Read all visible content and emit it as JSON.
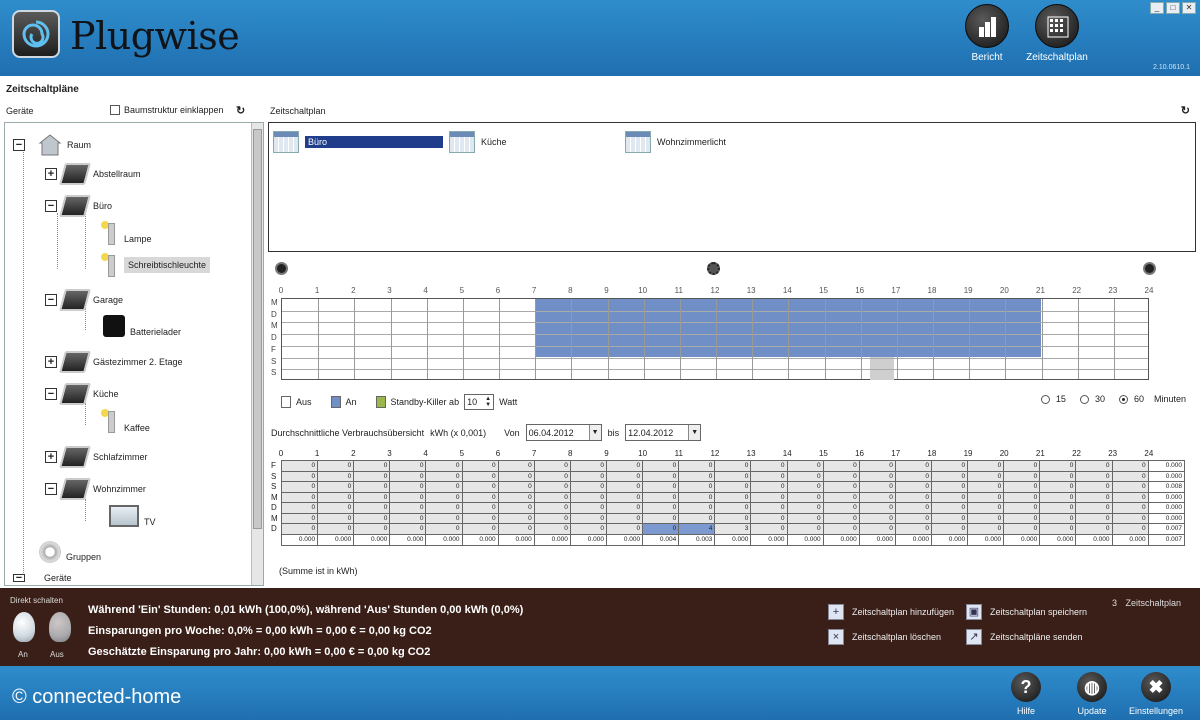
{
  "app": {
    "brand": "Plugwise",
    "version": "2.10.0610.1",
    "window_controls": [
      "_",
      "□",
      "✕"
    ],
    "header_buttons": [
      {
        "label": "Bericht",
        "icon": "report-chart-icon"
      },
      {
        "label": "Zeitschaltplan",
        "icon": "schedule-grid-icon"
      }
    ]
  },
  "page_title": "Zeitschaltpläne",
  "left": {
    "header": "Geräte",
    "collapse_label": "Baumstruktur einklappen",
    "refresh_icon": "refresh-icon",
    "tree": [
      {
        "label": "Raum",
        "pm": "−"
      },
      {
        "label": "Abstellraum",
        "pm": "+"
      },
      {
        "label": "Büro",
        "pm": "−"
      },
      {
        "label": "Lampe"
      },
      {
        "label": "Schreibtischleuchte"
      },
      {
        "label": "Garage",
        "pm": "−"
      },
      {
        "label": "Batterielader"
      },
      {
        "label": "Gästezimmer 2. Etage",
        "pm": "+"
      },
      {
        "label": "Küche",
        "pm": "−"
      },
      {
        "label": "Kaffee"
      },
      {
        "label": "Schlafzimmer",
        "pm": "+"
      },
      {
        "label": "Wohnzimmer",
        "pm": "−"
      },
      {
        "label": "TV"
      },
      {
        "label": "Gruppen"
      },
      {
        "label": "Geräte"
      }
    ]
  },
  "right": {
    "header": "Zeitschaltplan",
    "schedules": [
      "Büro",
      "Küche",
      "Wohnzimmerlicht"
    ],
    "hours": [
      "0",
      "1",
      "2",
      "3",
      "4",
      "5",
      "6",
      "7",
      "8",
      "9",
      "10",
      "11",
      "12",
      "13",
      "14",
      "15",
      "16",
      "17",
      "18",
      "19",
      "20",
      "21",
      "22",
      "23",
      "24"
    ],
    "day_letters": [
      "M",
      "D",
      "M",
      "D",
      "F",
      "S",
      "S"
    ],
    "legend": {
      "aus": "Aus",
      "an": "An",
      "standby": "Standby-Killer ab",
      "watt_value": "10",
      "watt_unit": "Watt",
      "colors": {
        "aus": "#ffffff",
        "an": "#6f8fc6",
        "standby": "#9ab84a"
      }
    },
    "interval": {
      "options": [
        "15",
        "30",
        "60"
      ],
      "selected": "60",
      "unit": "Minuten"
    }
  },
  "consumption": {
    "title": "Durchschnittliche Verbrauchsübersicht",
    "unit": "kWh (x 0,001)",
    "von_label": "Von",
    "von_value": "06.04.2012",
    "bis_label": "bis",
    "bis_value": "12.04.2012",
    "day_letters": [
      "F",
      "S",
      "S",
      "M",
      "D",
      "M",
      "D"
    ],
    "rows": [
      [
        "0",
        "0",
        "0",
        "0",
        "0",
        "0",
        "0",
        "0",
        "0",
        "0",
        "0",
        "0",
        "0",
        "0",
        "0",
        "0",
        "0",
        "0",
        "0",
        "0",
        "0",
        "0",
        "0",
        "0",
        "0.000"
      ],
      [
        "0",
        "0",
        "0",
        "0",
        "0",
        "0",
        "0",
        "0",
        "0",
        "0",
        "0",
        "0",
        "0",
        "0",
        "0",
        "0",
        "0",
        "0",
        "0",
        "0",
        "0",
        "0",
        "0",
        "0",
        "0.000"
      ],
      [
        "0",
        "0",
        "0",
        "0",
        "0",
        "0",
        "0",
        "0",
        "0",
        "0",
        "0",
        "0",
        "0",
        "0",
        "0",
        "0",
        "0",
        "0",
        "0",
        "0",
        "0",
        "0",
        "0",
        "0",
        "0.008"
      ],
      [
        "0",
        "0",
        "0",
        "0",
        "0",
        "0",
        "0",
        "0",
        "0",
        "0",
        "0",
        "0",
        "0",
        "0",
        "0",
        "0",
        "0",
        "0",
        "0",
        "0",
        "0",
        "0",
        "0",
        "0",
        "0.000"
      ],
      [
        "0",
        "0",
        "0",
        "0",
        "0",
        "0",
        "0",
        "0",
        "0",
        "0",
        "0",
        "0",
        "0",
        "0",
        "0",
        "0",
        "0",
        "0",
        "0",
        "0",
        "0",
        "0",
        "0",
        "0",
        "0.000"
      ],
      [
        "0",
        "0",
        "0",
        "0",
        "0",
        "0",
        "0",
        "0",
        "0",
        "0",
        "0",
        "0",
        "0",
        "0",
        "0",
        "0",
        "0",
        "0",
        "0",
        "0",
        "0",
        "0",
        "0",
        "0",
        "0.000"
      ],
      [
        "0",
        "0",
        "0",
        "0",
        "0",
        "0",
        "0",
        "0",
        "0",
        "0",
        "0",
        "4",
        "3",
        "0",
        "0",
        "0",
        "0",
        "0",
        "0",
        "0",
        "0",
        "0",
        "0",
        "0",
        "0.007"
      ]
    ],
    "sums": [
      "0.000",
      "0.000",
      "0.000",
      "0.000",
      "0.000",
      "0.000",
      "0.000",
      "0.000",
      "0.000",
      "0.000",
      "0.004",
      "0.003",
      "0.000",
      "0.000",
      "0.000",
      "0.000",
      "0.000",
      "0.000",
      "0.000",
      "0.000",
      "0.000",
      "0.000",
      "0.000",
      "0.000",
      "0.007"
    ],
    "note": "(Summe ist in kWh)"
  },
  "footer": {
    "direct_label": "Direkt schalten",
    "on_label": "An",
    "off_label": "Aus",
    "stats": [
      "Während 'Ein' Stunden: 0,01 kWh (100,0%), während 'Aus' Stunden 0,00 kWh (0,0%)",
      "Einsparungen pro Woche: 0,0% = 0,00 kWh = 0,00 € = 0,00 kg CO2",
      "Geschätzte Einsparung pro Jahr: 0,00 kWh = 0,00 € = 0,00 kg CO2"
    ],
    "actions": {
      "add": "Zeitschaltplan hinzufügen",
      "save": "Zeitschaltplan speichern",
      "delete": "Zeitschaltplan löschen",
      "send": "Zeitschaltpläne senden"
    },
    "count": "3",
    "count_label": "Zeitschaltplan"
  },
  "bottom": {
    "copyright": "© connected-home",
    "buttons": [
      "Hilfe",
      "Update",
      "Einstellungen"
    ]
  }
}
